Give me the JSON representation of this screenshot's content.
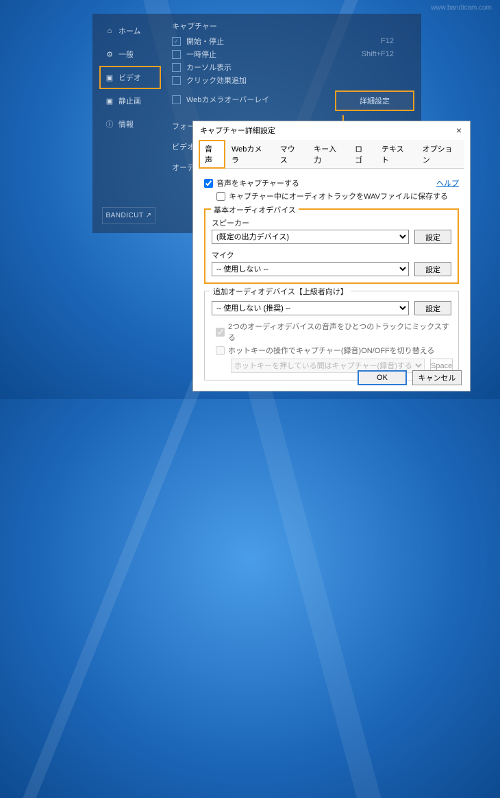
{
  "watermark_text": "www.bandicam.com",
  "sidebar": {
    "items": [
      {
        "icon": "⌂",
        "label": "ホーム"
      },
      {
        "icon": "⚙",
        "label": "一般"
      },
      {
        "icon": "▣",
        "label": "ビデオ"
      },
      {
        "icon": "▣",
        "label": "静止画"
      },
      {
        "icon": "ⓘ",
        "label": "情報"
      }
    ]
  },
  "capture": {
    "section_label": "キャプチャー",
    "items": [
      {
        "checked": true,
        "label": "開始・停止",
        "hotkey": "F12"
      },
      {
        "checked": false,
        "label": "一時停止",
        "hotkey": "Shift+F12"
      },
      {
        "checked": false,
        "label": "カーソル表示",
        "hotkey": ""
      },
      {
        "checked": false,
        "label": "クリック効果追加",
        "hotkey": ""
      },
      {
        "checked": false,
        "label": "Webカメラオーバーレイ",
        "hotkey": ""
      }
    ],
    "detail_button": "詳細設定"
  },
  "extra_sections": {
    "format_label": "フォー...",
    "video_label": "ビデオ",
    "other_label": "オーデ..."
  },
  "banner_label": "BANDICUT ↗",
  "dialog": {
    "title": "キャプチャー詳細設定",
    "tabs": [
      "音声",
      "Webカメラ",
      "マウス",
      "キー入力",
      "ロゴ",
      "テキスト",
      "オプション"
    ],
    "capture_sound": "音声をキャプチャーする",
    "save_wav": "キャプチャー中にオーディオトラックをWAVファイルに保存する",
    "help_label": "ヘルプ",
    "group_basic": {
      "title": "基本オーディオデバイス",
      "speaker_label": "スピーカー",
      "speaker_value": "(既定の出力デバイス)",
      "mic_label": "マイク",
      "mic_value": "-- 使用しない --",
      "config_btn": "設定"
    },
    "group_add": {
      "title": "追加オーディオデバイス【上級者向け】",
      "value": "-- 使用しない (推奨) --",
      "config_btn": "設定"
    },
    "mix_two": "2つのオーディオデバイスの音声をひとつのトラックにミックスする",
    "hotkey_toggle": "ホットキーの操作でキャプチャー(録音)ON/OFFを切り替える",
    "hotkey_select": "ホットキーを押している間はキャプチャー(録音)する",
    "hotkey_key": "Space",
    "ok": "OK",
    "cancel": "キャンセル"
  }
}
